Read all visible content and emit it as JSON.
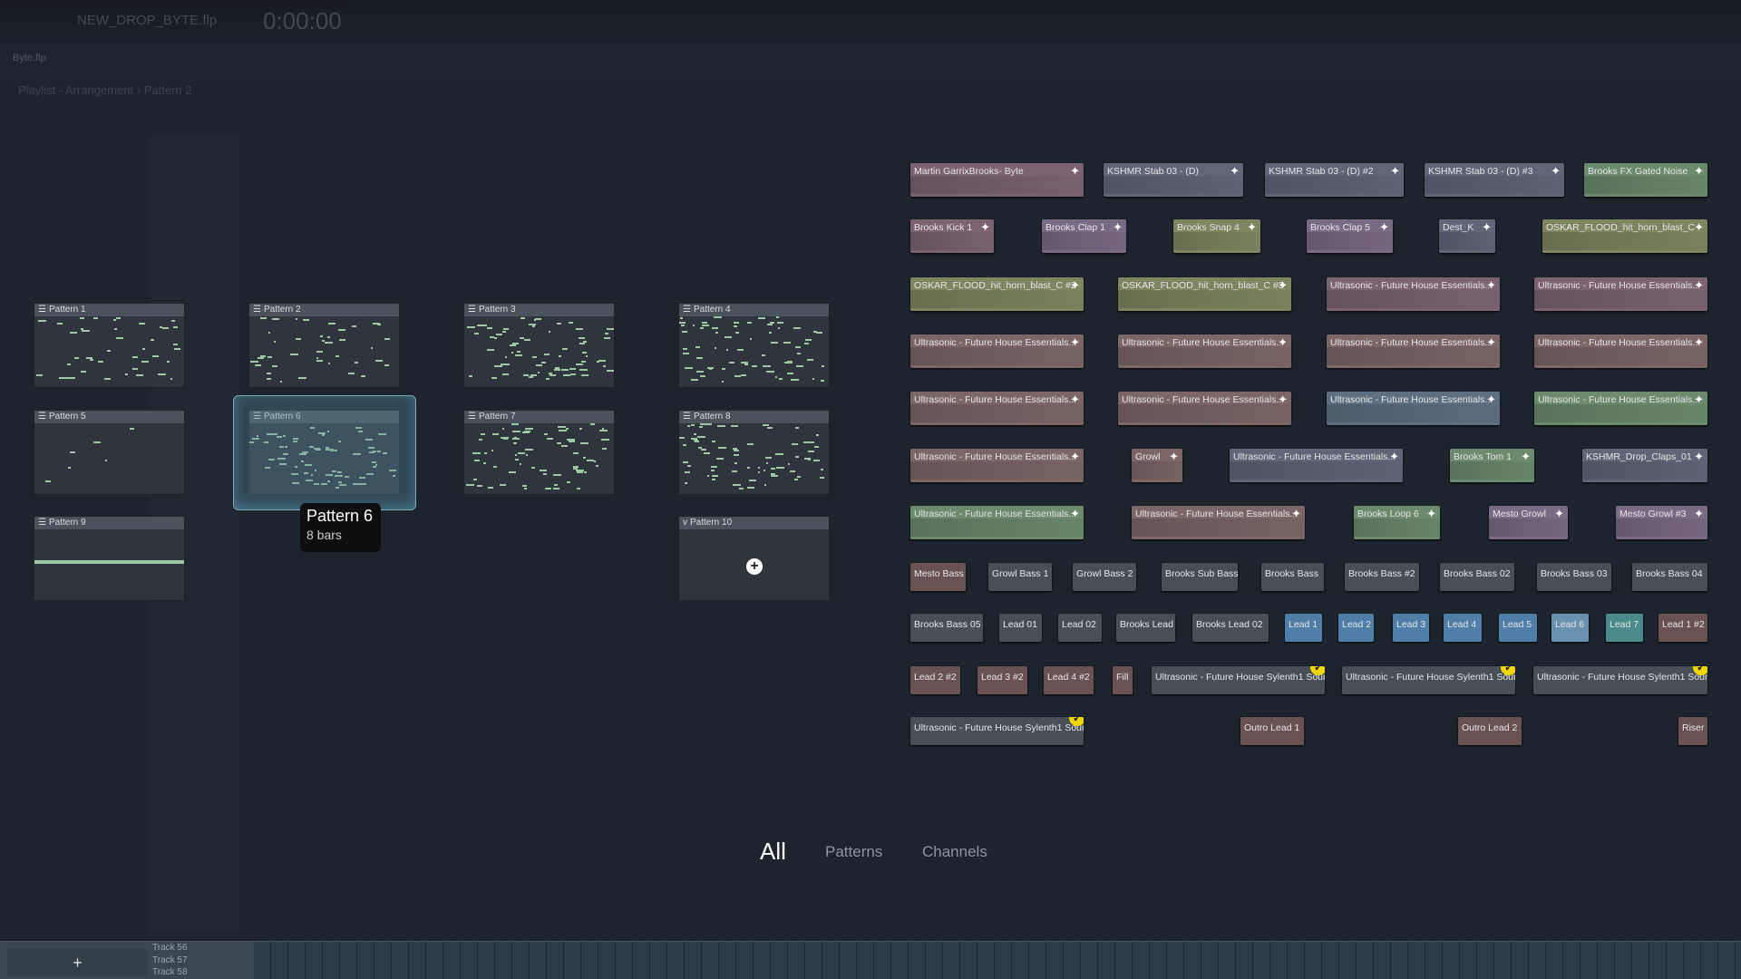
{
  "background": {
    "title": "NEW_DROP_BYTE.flp",
    "time": "0:00:00",
    "hint": "Byte.flp",
    "breadcrumb": "Playlist - Arrangement › Pattern 2",
    "tracks": [
      "Track 56",
      "Track 57",
      "Track 58"
    ],
    "add": "+"
  },
  "patterns": [
    {
      "label": "Pattern 1",
      "icon": "pattern-icon"
    },
    {
      "label": "Pattern 2",
      "icon": "pattern-icon"
    },
    {
      "label": "Pattern 3",
      "icon": "pattern-icon"
    },
    {
      "label": "Pattern 4",
      "icon": "pattern-icon"
    },
    {
      "label": "Pattern 5",
      "icon": "pattern-icon"
    },
    {
      "label": "Pattern 6",
      "icon": "pattern-icon"
    },
    {
      "label": "Pattern 7",
      "icon": "pattern-icon"
    },
    {
      "label": "Pattern 8",
      "icon": "pattern-icon"
    },
    {
      "label": "Pattern 9",
      "icon": "pattern-icon"
    },
    {
      "label": "Pattern 10",
      "icon": "chevron-down-icon"
    }
  ],
  "tooltip": {
    "title": "Pattern 6",
    "subtitle": "8 bars"
  },
  "colors": {
    "rose": "#7b6470",
    "slate": "#5f6676",
    "olive": "#7d865f",
    "purple": "#7a6a84",
    "brown": "#7c6666",
    "green": "#6b8a6e",
    "blue": "#5f6f82",
    "chan": "#465056",
    "lead": "#4f7ea8",
    "leadlt": "#6a90b0",
    "teal": "#4a8a8a",
    "leadbr": "#6a5252",
    "check": "#f2d600"
  },
  "clips": [
    {
      "label": "Martin GarrixBrooks-  Byte",
      "c": "rose",
      "audio": true
    },
    {
      "label": "KSHMR Stab 03 - (D)",
      "c": "slate",
      "audio": true
    },
    {
      "label": "KSHMR Stab 03 - (D) #2",
      "c": "slate",
      "audio": true
    },
    {
      "label": "KSHMR Stab 03 - (D) #3",
      "c": "slate",
      "audio": true
    },
    {
      "label": "Brooks FX Gated Noise",
      "c": "green",
      "audio": true
    },
    {
      "label": "Brooks Kick 1",
      "c": "rose",
      "audio": true
    },
    {
      "label": "Brooks Clap 1",
      "c": "purple",
      "audio": true
    },
    {
      "label": "Brooks Snap 4",
      "c": "olive",
      "audio": true
    },
    {
      "label": "Brooks Clap 5",
      "c": "purple",
      "audio": true
    },
    {
      "label": "Dest_K",
      "c": "slate",
      "audio": true
    },
    {
      "label": "OSKAR_FLOOD_hit_horn_blast_C",
      "c": "olive",
      "audio": true
    },
    {
      "label": "OSKAR_FLOOD_hit_horn_blast_C #2",
      "c": "olive",
      "audio": true
    },
    {
      "label": "OSKAR_FLOOD_hit_horn_blast_C #3",
      "c": "olive",
      "audio": true
    },
    {
      "label": "Ultrasonic - Future House Essentials..",
      "c": "rose",
      "audio": true
    },
    {
      "label": "Ultrasonic - Future House Essentials..",
      "c": "rose",
      "audio": true
    },
    {
      "label": "Ultrasonic - Future House Essentials..",
      "c": "brown",
      "audio": true
    },
    {
      "label": "Ultrasonic - Future House Essentials..",
      "c": "brown",
      "audio": true
    },
    {
      "label": "Ultrasonic - Future House Essentials..",
      "c": "brown",
      "audio": true
    },
    {
      "label": "Ultrasonic - Future House Essentials..",
      "c": "brown",
      "audio": true
    },
    {
      "label": "Ultrasonic - Future House Essentials..",
      "c": "brown",
      "audio": true
    },
    {
      "label": "Ultrasonic - Future House Essentials..",
      "c": "brown",
      "audio": true
    },
    {
      "label": "Ultrasonic - Future House Essentials..",
      "c": "blue",
      "audio": true
    },
    {
      "label": "Ultrasonic - Future House Essentials..",
      "c": "green",
      "audio": true
    },
    {
      "label": "Ultrasonic - Future House Essentials..",
      "c": "brown",
      "audio": true
    },
    {
      "label": "Growl",
      "c": "brown",
      "audio": true
    },
    {
      "label": "Ultrasonic - Future House Essentials..",
      "c": "slate",
      "audio": true
    },
    {
      "label": "Brooks Tom 1",
      "c": "green",
      "audio": true
    },
    {
      "label": "KSHMR_Drop_Claps_01",
      "c": "slate",
      "audio": true
    },
    {
      "label": "Ultrasonic - Future House Essentials..",
      "c": "green",
      "audio": true
    },
    {
      "label": "Ultrasonic - Future House Essentials..",
      "c": "brown",
      "audio": true
    },
    {
      "label": "Brooks Loop 6",
      "c": "green",
      "audio": true
    },
    {
      "label": "Mesto Growl",
      "c": "purple",
      "audio": true
    },
    {
      "label": "Mesto Growl #3",
      "c": "purple",
      "audio": true
    },
    {
      "label": "Mesto Bass",
      "c": "leadbr"
    },
    {
      "label": "Growl Bass 1",
      "c": "chan"
    },
    {
      "label": "Growl Bass 2",
      "c": "chan"
    },
    {
      "label": "Brooks Sub Bass",
      "c": "chan"
    },
    {
      "label": "Brooks Bass",
      "c": "chan"
    },
    {
      "label": "Brooks Bass #2",
      "c": "chan"
    },
    {
      "label": "Brooks Bass 02",
      "c": "chan"
    },
    {
      "label": "Brooks Bass 03",
      "c": "chan"
    },
    {
      "label": "Brooks Bass 04",
      "c": "chan"
    },
    {
      "label": "Brooks Bass 05",
      "c": "chan"
    },
    {
      "label": "Lead 01",
      "c": "chan"
    },
    {
      "label": "Lead 02",
      "c": "chan"
    },
    {
      "label": "Brooks Lead",
      "c": "chan"
    },
    {
      "label": "Brooks Lead 02",
      "c": "chan"
    },
    {
      "label": "Lead 1",
      "c": "lead"
    },
    {
      "label": "Lead 2",
      "c": "lead"
    },
    {
      "label": "Lead 3",
      "c": "lead"
    },
    {
      "label": "Lead 4",
      "c": "lead"
    },
    {
      "label": "Lead 5",
      "c": "lead"
    },
    {
      "label": "Lead 6",
      "c": "leadlt"
    },
    {
      "label": "Lead 7",
      "c": "teal"
    },
    {
      "label": "Lead 1 #2",
      "c": "leadbr"
    },
    {
      "label": "Lead 2 #2",
      "c": "leadbr"
    },
    {
      "label": "Lead 3 #2",
      "c": "leadbr"
    },
    {
      "label": "Lead 4 #2",
      "c": "leadbr"
    },
    {
      "label": "Fill",
      "c": "leadbr"
    },
    {
      "label": "Ultrasonic - Future House Sylenth1 Soun",
      "c": "chan",
      "checked": true
    },
    {
      "label": "Ultrasonic - Future House Sylenth1 Soun",
      "c": "chan",
      "checked": true
    },
    {
      "label": "Ultrasonic - Future House Sylenth1 Soun",
      "c": "chan",
      "checked": true
    },
    {
      "label": "Ultrasonic - Future House Sylenth1 Soun",
      "c": "chan",
      "checked": true
    },
    {
      "label": "Outro Lead 1",
      "c": "leadbr"
    },
    {
      "label": "Outro Lead 2",
      "c": "leadbr"
    },
    {
      "label": "Riser",
      "c": "leadbr"
    }
  ],
  "tabs": [
    {
      "label": "All",
      "active": true
    },
    {
      "label": "Patterns"
    },
    {
      "label": "Channels"
    }
  ]
}
